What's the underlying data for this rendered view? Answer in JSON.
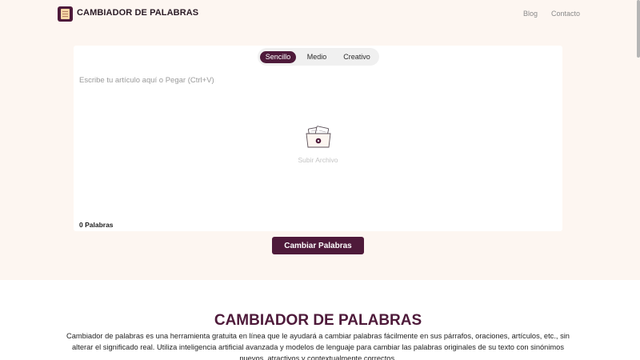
{
  "header": {
    "brand": "CAMBIADOR DE PALABRAS",
    "nav": [
      {
        "label": "Blog"
      },
      {
        "label": "Contacto"
      }
    ]
  },
  "editor": {
    "modes": [
      {
        "label": "Sencillo",
        "active": true
      },
      {
        "label": "Medio",
        "active": false
      },
      {
        "label": "Creativo",
        "active": false
      }
    ],
    "placeholder": "Escribe tu artículo aquí o Pegar (Ctrl+V)",
    "upload_label": "Subir Archivo",
    "word_count": "0 Palabras",
    "submit_label": "Cambiar Palabras"
  },
  "section": {
    "title": "CAMBIADOR DE PALABRAS",
    "description": "Cambiador de palabras es una herramienta gratuita en línea que le ayudará a cambiar palabras fácilmente en sus párrafos, oraciones, artículos, etc., sin alterar el significado real. Utiliza inteligencia artificial avanzada y modelos de lenguaje para cambiar las palabras originales de su texto con sinónimos nuevos, atractivos y contextualmente correctos."
  },
  "colors": {
    "accent": "#4e1a3a",
    "hero_background": "#fdf6f1"
  },
  "icons": {
    "logo": "notepad-icon",
    "upload": "file-upload-icon"
  }
}
